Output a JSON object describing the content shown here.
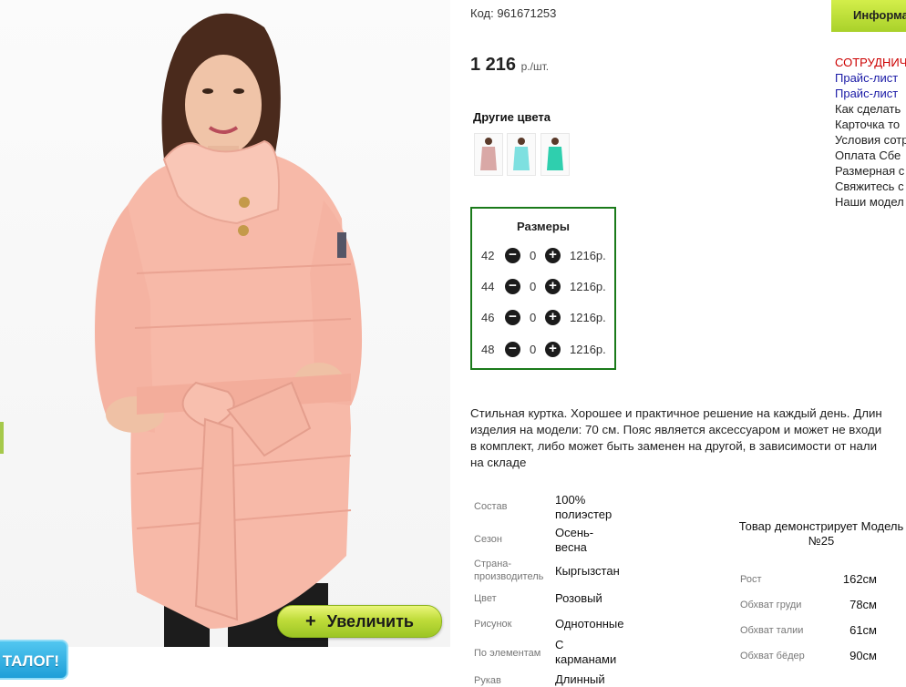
{
  "product": {
    "code": "Код: 961671253",
    "price": "1 216",
    "price_unit": "р./шт.",
    "zoom_label": "Увеличить",
    "zoom_icon": "plus-icon"
  },
  "catalog_badge": "ТАЛОГ!",
  "other_colors": {
    "title": "Другие цвета",
    "swatches": [
      {
        "name": "pink",
        "color": "#d9a8a6"
      },
      {
        "name": "aqua",
        "color": "#7ee0e0"
      },
      {
        "name": "turquoise",
        "color": "#2fcfae"
      }
    ]
  },
  "sizes": {
    "title": "Размеры",
    "rows": [
      {
        "size": "42",
        "qty": "0",
        "price": "1216р."
      },
      {
        "size": "44",
        "qty": "0",
        "price": "1216р."
      },
      {
        "size": "46",
        "qty": "0",
        "price": "1216р."
      },
      {
        "size": "48",
        "qty": "0",
        "price": "1216р."
      }
    ]
  },
  "description_lines": [
    "Стильная куртка. Хорошее и практичное решение на каждый день. Длин",
    "изделия на модели: 70 см. Пояс является аксессуаром и может не входи",
    "в комплект, либо может быть заменен на другой, в зависимости от нали",
    "на складе"
  ],
  "specs": {
    "composition_label": "Состав",
    "composition_value": "100% полиэстер",
    "season_label": "Сезон",
    "season_value": "Осень-весна",
    "country_label": "Страна-производитель",
    "country_value": "Кыргызстан",
    "color_label": "Цвет",
    "color_value": "Розовый",
    "pattern_label": "Рисунок",
    "pattern_value": "Однотонные",
    "elements_label": "По элементам",
    "elements_value": "С карманами",
    "sleeve_label": "Рукав",
    "sleeve_value": "Длинный"
  },
  "model": {
    "title": "Товар демонстрирует Модель №25",
    "height_label": "Рост",
    "height_value": "162см",
    "chest_label": "Обхват груди",
    "chest_value": "78см",
    "waist_label": "Обхват талии",
    "waist_value": "61см",
    "hips_label": "Обхват бёдер",
    "hips_value": "90см"
  },
  "right_panel": {
    "info_button": "Информа",
    "links": [
      {
        "text": "СОТРУДНИЧ",
        "color": "#cc0000"
      },
      {
        "text": "Прайс-лист",
        "color": "#1a1aa6"
      },
      {
        "text": "Прайс-лист",
        "color": "#1a1aa6"
      },
      {
        "text": "Как сделать",
        "color": "#222222"
      },
      {
        "text": "Карточка то",
        "color": "#222222"
      },
      {
        "text": "Условия сотр",
        "color": "#222222"
      },
      {
        "text": "Оплата Сбе",
        "color": "#222222"
      },
      {
        "text": "Размерная с",
        "color": "#222222"
      },
      {
        "text": "Свяжитесь с",
        "color": "#222222"
      },
      {
        "text": "Наши модел",
        "color": "#222222"
      }
    ]
  },
  "colors": {
    "accent_green": "#1a7a1a",
    "button_lime": "#bfdc3a",
    "jacket_pink": "#f7b9a8"
  }
}
